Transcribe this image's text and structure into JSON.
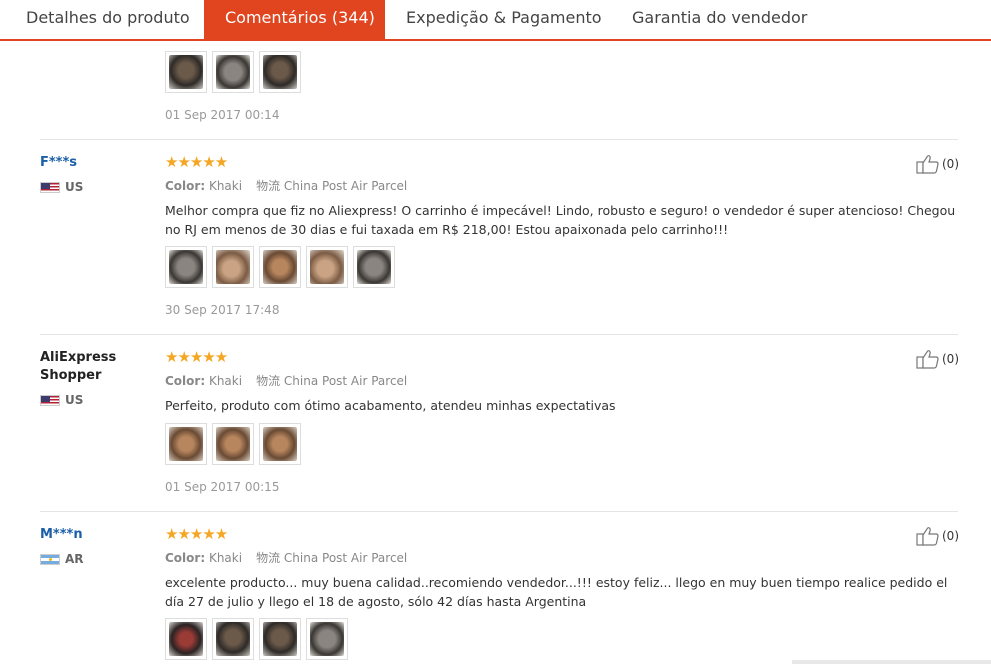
{
  "tabs": [
    {
      "label": "Detalhes do produto",
      "active": false
    },
    {
      "label": "Comentários (344)",
      "active": true
    },
    {
      "label": "Expedição & Pagamento",
      "active": false
    },
    {
      "label": "Garantia do vendedor",
      "active": false
    }
  ],
  "colors": {
    "accent": "#e0451f",
    "star": "#f5a623",
    "user_link": "#1a5fa8"
  },
  "star_glyphs": "★★★★★",
  "meta_labels": {
    "color_label": "Color:",
    "color_value": "Khaki",
    "shipping_label": "物流",
    "shipping_value": "China Post Air Parcel"
  },
  "reviews": [
    {
      "partial": true,
      "photos": [
        "dark",
        "gray",
        "dark"
      ],
      "date": "01 Sep 2017 00:14"
    },
    {
      "user": "F***s",
      "country": "US",
      "rating": 5,
      "text": "Melhor compra que fiz no Aliexpress! O carrinho é impecável! Lindo, robusto e seguro! o vendedor é super atencioso! Chegou no RJ em menos de 30 dias e fui taxada em R$ 218,00! Estou apaixonada pelo carrinho!!!",
      "photos": [
        "gray",
        "tan",
        "brown",
        "tan",
        "gray"
      ],
      "date": "30 Sep 2017 17:48",
      "likes": "(0)"
    },
    {
      "user": "AliExpress Shopper",
      "country": "US",
      "rating": 5,
      "text": "Perfeito, produto com ótimo acabamento, atendeu minhas expectativas",
      "photos": [
        "brown",
        "brown",
        "brown"
      ],
      "date": "01 Sep 2017 00:15",
      "likes": "(0)"
    },
    {
      "user": "M***n",
      "country": "AR",
      "rating": 5,
      "text": "excelente producto... muy buena calidad..recomiendo vendedor...!!! estoy feliz... llego en muy buen tiempo realice pedido el día 27 de julio y llego el 18 de agosto, sólo 42 días hasta Argentina",
      "photos": [
        "red",
        "dark",
        "dark",
        "gray"
      ],
      "likes": "(0)"
    }
  ]
}
